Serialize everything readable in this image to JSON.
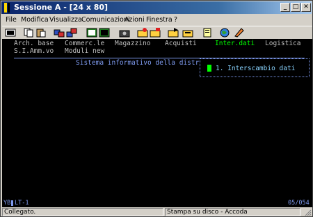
{
  "window": {
    "title": "Sessione A - [24 x 80]"
  },
  "menu": {
    "items": [
      "File",
      "Modifica",
      "Visualizza",
      "Comunicazioni",
      "Azioni",
      "Finestra",
      "?"
    ]
  },
  "toolbar": {
    "icons": [
      "print-screen-icon",
      "copy-icon",
      "paste-icon",
      "send-icon",
      "receive-icon",
      "display-icon",
      "keyboard-icon",
      "camera-icon",
      "macro-record-icon",
      "macro-stop-icon",
      "macro-play-icon",
      "clipboard-icon",
      "globe-icon",
      "help-icon"
    ]
  },
  "screen": {
    "row1": {
      "arch": "Arch. base",
      "commerc": "Commerc.le",
      "magazzino": "Magazzino",
      "acquisti": "Acquisti",
      "inter": "Inter.dati",
      "logistica": "Logistica"
    },
    "row2": {
      "amm": "S.I.Amm.vo",
      "moduli": "Moduli new"
    },
    "sistema": "Sistema informativo della distr",
    "popup_item": "1. Interscambio dati"
  },
  "oia": {
    "left": "YB",
    "code": "LT-1",
    "cursor": "05/054"
  },
  "statusbar": {
    "connection": "Collegato.",
    "print": "Stampa su disco - Accoda"
  },
  "colors": {
    "title_start": "#0a246a",
    "title_end": "#a6caf0",
    "terminal_bg": "#000000",
    "terminal_green": "#00ff00",
    "terminal_blue": "#7f9bf0"
  }
}
